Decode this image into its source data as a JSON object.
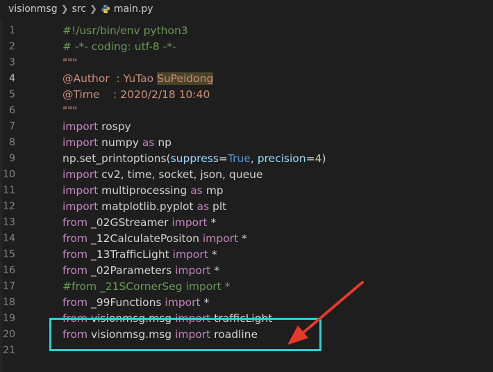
{
  "breadcrumb": {
    "folder": "visionmsg",
    "subfolder": "src",
    "file": "main.py"
  },
  "colors": {
    "highlight_box": "#2fd0d6",
    "arrow": "#e8392f"
  },
  "lines": [
    {
      "n": "1"
    },
    {
      "n": "2"
    },
    {
      "n": "3"
    },
    {
      "n": "4"
    },
    {
      "n": "5"
    },
    {
      "n": "6"
    },
    {
      "n": "7"
    },
    {
      "n": "8"
    },
    {
      "n": "9"
    },
    {
      "n": "10"
    },
    {
      "n": "11"
    },
    {
      "n": "12"
    },
    {
      "n": "13"
    },
    {
      "n": "14"
    },
    {
      "n": "15"
    },
    {
      "n": "16"
    },
    {
      "n": "17"
    },
    {
      "n": "18"
    },
    {
      "n": "19"
    },
    {
      "n": "20"
    },
    {
      "n": "21"
    }
  ],
  "code": {
    "l1": "#!/usr/bin/env python3",
    "l2": "# -*- coding: utf-8 -*-",
    "l3": "\"\"\"",
    "l4_a": "@Author  : YuTao ",
    "l4_b": "SuPeidong",
    "l5": "@Time    : 2020/2/18 10:40",
    "l6": "\"\"\"",
    "kw_import": "import",
    "kw_from": "from",
    "kw_as": "as",
    "l7_mod": " rospy",
    "l8_mod": " numpy ",
    "l8_alias": " np",
    "l9_a": "np.set_printoptions(",
    "l9_p1": "suppress",
    "l9_eq1": "=",
    "l9_v1": "True",
    "l9_c": ", ",
    "l9_p2": "precision",
    "l9_eq2": "=",
    "l9_v2": "4",
    "l9_end": ")",
    "l10_mod": " cv2, time, socket, json, queue",
    "l11_mod": " multiprocessing ",
    "l11_alias": " mp",
    "l12_mod": " matplotlib.pyplot ",
    "l12_alias": " plt",
    "l13_mod": " _02GStreamer ",
    "l14_mod": " _12CalculatePositon ",
    "l15_mod": " _13TrafficLight ",
    "l16_mod": " _02Parameters ",
    "l17": "#from _21SCornerSeg import *",
    "l18_mod": " _99Functions ",
    "l19_mod": " visionmsg.msg ",
    "l19_name": " trafficLight",
    "l20_mod": " visionmsg.msg ",
    "l20_name": " roadline",
    "star": " *"
  }
}
